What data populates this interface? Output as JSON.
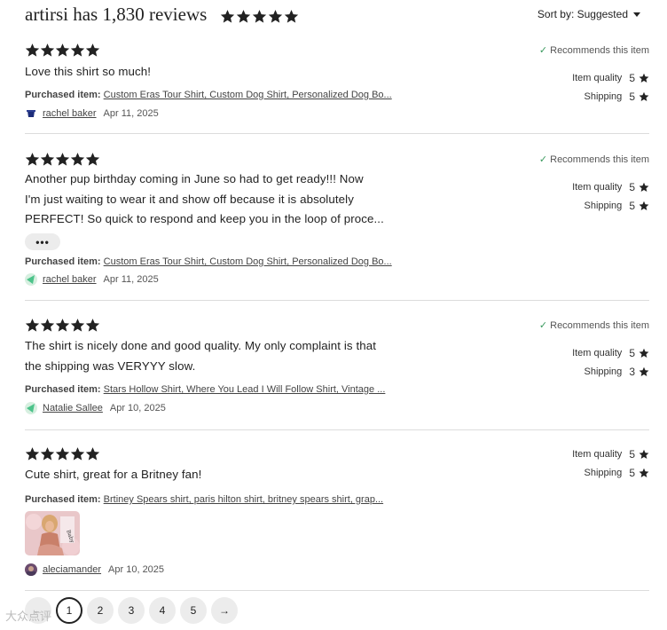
{
  "header": {
    "title": "artirsi has 1,830 reviews",
    "sort_label": "Sort by: Suggested"
  },
  "reviews": [
    {
      "stars": 5,
      "text_lines": [
        "Love this shirt so much!"
      ],
      "purchased_label": "Purchased item:",
      "purchased_item": "Custom Eras Tour Shirt, Custom Dog Shirt, Personalized Dog Bo...",
      "reviewer": "rachel baker",
      "date": "Apr 11, 2025",
      "recommends": "Recommends this item",
      "item_quality_label": "Item quality",
      "item_quality": "5",
      "shipping_label": "Shipping",
      "shipping": "5"
    },
    {
      "stars": 5,
      "text_lines": [
        "Another pup birthday coming in June so had to get ready!!! Now",
        "I'm just waiting to wear it and show off because it is absolutely",
        "PERFECT! So quick to respond and keep you in the loop of proce..."
      ],
      "expand_label": "•••",
      "purchased_label": "Purchased item:",
      "purchased_item": "Custom Eras Tour Shirt, Custom Dog Shirt, Personalized Dog Bo...",
      "reviewer": "rachel baker",
      "date": "Apr 11, 2025",
      "recommends": "Recommends this item",
      "item_quality_label": "Item quality",
      "item_quality": "5",
      "shipping_label": "Shipping",
      "shipping": "5"
    },
    {
      "stars": 5,
      "text_lines": [
        "The shirt is nicely done and good quality. My only complaint is that",
        "the shipping was VERYYY slow."
      ],
      "purchased_label": "Purchased item:",
      "purchased_item": "Stars Hollow Shirt, Where You Lead I Will Follow Shirt, Vintage ...",
      "reviewer": "Natalie Sallee",
      "date": "Apr 10, 2025",
      "recommends": "Recommends this item",
      "item_quality_label": "Item quality",
      "item_quality": "5",
      "shipping_label": "Shipping",
      "shipping": "3"
    },
    {
      "stars": 5,
      "text_lines": [
        "Cute shirt, great for a Britney fan!"
      ],
      "purchased_label": "Purchased item:",
      "purchased_item": "Brtiney Spears shirt, paris hilton shirt, britney spears shirt, grap...",
      "reviewer": "aleciamander",
      "date": "Apr 10, 2025",
      "item_quality_label": "Item quality",
      "item_quality": "5",
      "shipping_label": "Shipping",
      "shipping": "5"
    }
  ],
  "pagination": {
    "prev": "←",
    "pages": [
      "1",
      "2",
      "3",
      "4",
      "5"
    ],
    "current": "1",
    "next": "→"
  },
  "watermark": "大众点评"
}
